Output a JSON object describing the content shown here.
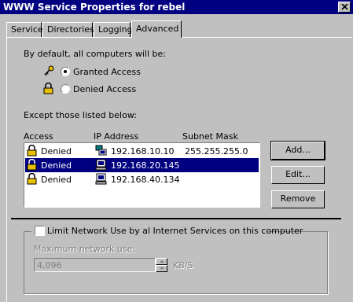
{
  "window": {
    "title": "WWW Service Properties for rebel",
    "close_icon": "close-icon"
  },
  "tabs": [
    {
      "label": "Service"
    },
    {
      "label": "Directories"
    },
    {
      "label": "Logging"
    },
    {
      "label": "Advanced",
      "active": true
    }
  ],
  "access": {
    "default_label": "By default, all computers will be:",
    "granted_label": "Granted Access",
    "denied_label": "Denied Access",
    "selected": "granted",
    "except_label": "Except those listed below:"
  },
  "list": {
    "columns": [
      "Access",
      "IP Address",
      "Subnet Mask"
    ],
    "rows": [
      {
        "access": "Denied",
        "ip": "192.168.10.10",
        "mask": "255.255.255.0",
        "selected": false
      },
      {
        "access": "Denied",
        "ip": "192.168.20.145",
        "mask": "",
        "selected": true
      },
      {
        "access": "Denied",
        "ip": "192.168.40.134",
        "mask": "",
        "selected": false
      }
    ]
  },
  "buttons": {
    "add": "Add...",
    "edit": "Edit...",
    "remove": "Remove"
  },
  "limit": {
    "checkbox_label": "Limit Network Use by al Internet Services on this computer",
    "checked": false,
    "max_label": "Maximum network use:",
    "value": "4,096",
    "unit": "KB/S"
  },
  "colors": {
    "title_bar": "#000080",
    "selection": "#000080",
    "face": "#c0c0c0"
  }
}
